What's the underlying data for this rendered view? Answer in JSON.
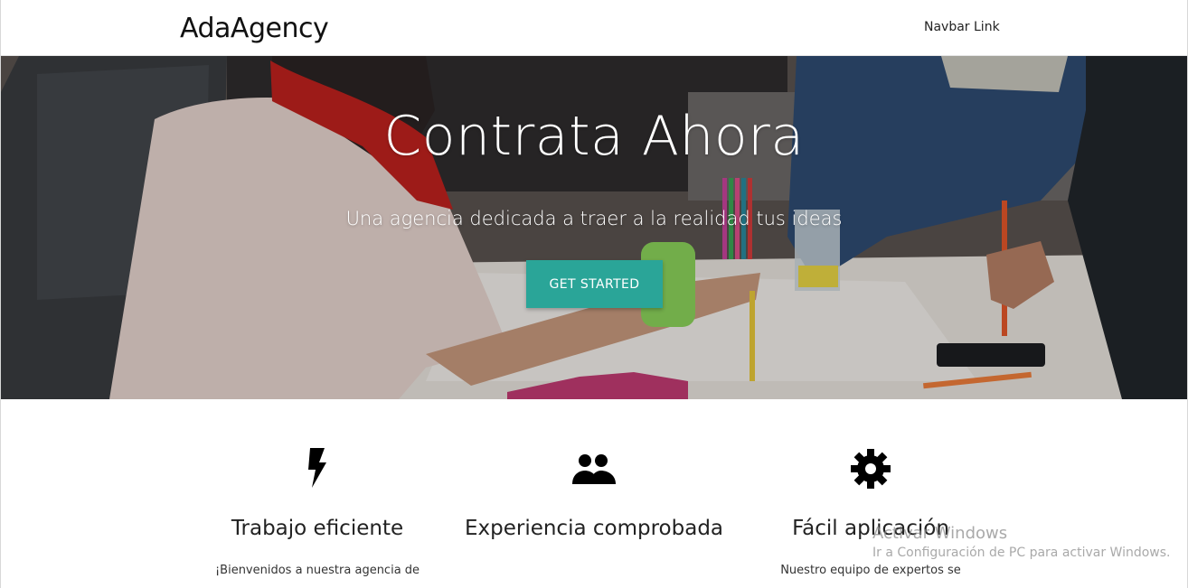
{
  "navbar": {
    "brand": "AdaAgency",
    "link": "Navbar Link"
  },
  "hero": {
    "title": "Contrata Ahora",
    "subtitle": "Una agencia dedicada a traer a la realidad tus ideas",
    "cta_label": "GET STARTED",
    "cta_color": "#2aa598"
  },
  "features": [
    {
      "icon": "bolt-icon",
      "title": "Trabajo eficiente",
      "text": "¡Bienvenidos a nuestra agencia de"
    },
    {
      "icon": "people-icon",
      "title": "Experiencia comprobada",
      "text": ""
    },
    {
      "icon": "gear-icon",
      "title": "Fácil aplicación",
      "text": "Nuestro equipo de expertos se"
    }
  ],
  "watermark": {
    "title": "Activar Windows",
    "text": "Ir a Configuración de PC para activar Windows."
  }
}
